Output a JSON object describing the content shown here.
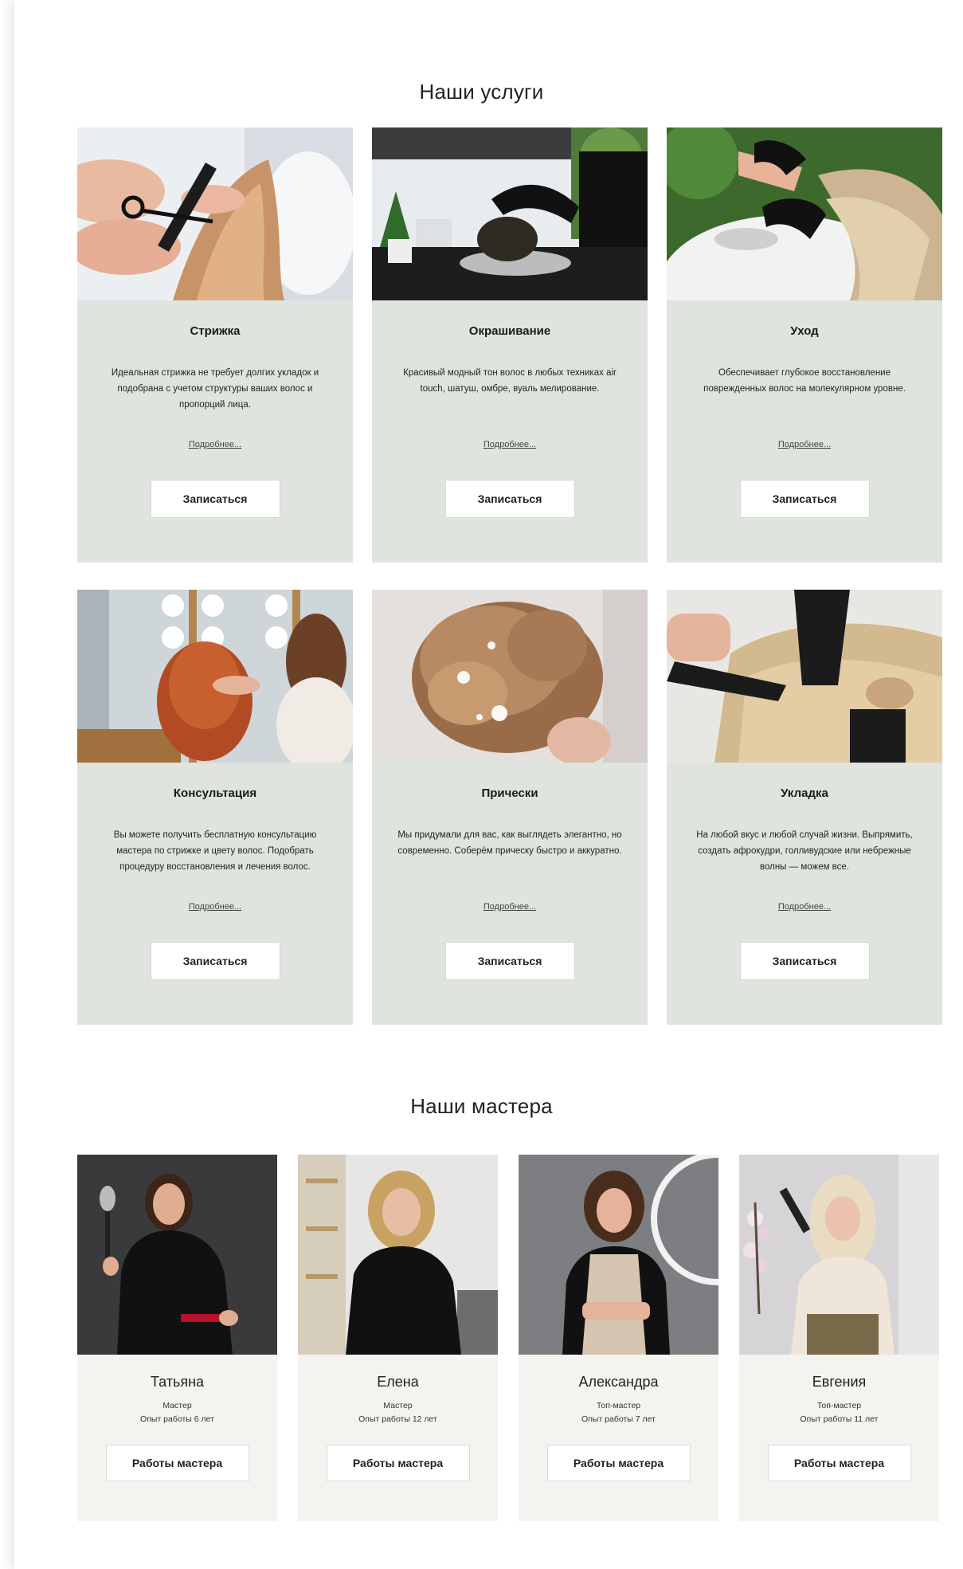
{
  "services": {
    "title": "Наши услуги",
    "cards": [
      {
        "title": "Стрижка",
        "description": "Идеальная стрижка не требует долгих укладок и подобрана с учетом структуры ваших волос и пропорций лица.",
        "more_label": "Подробнее...",
        "button_label": "Записаться"
      },
      {
        "title": "Окрашивание",
        "description": "Красивый модный тон волос в любых техниках air touch, шатуш, омбре, вуаль мелирование.",
        "more_label": "Подробнее...",
        "button_label": "Записаться"
      },
      {
        "title": "Уход",
        "description": "Обеспечивает глубокое восстановление поврежденных волос на молекулярном уровне.",
        "more_label": "Подробнее...",
        "button_label": "Записаться"
      },
      {
        "title": "Консультация",
        "description": "Вы можете получить бесплатную консультацию мастера по стрижке и цвету волос. Подобрать процедуру восстановления и лечения волос.",
        "more_label": "Подробнее...",
        "button_label": "Записаться"
      },
      {
        "title": "Прически",
        "description": "Мы придумали для вас, как выглядеть элегантно, но современно. Соберём прическу быстро и аккуратно.",
        "more_label": "Подробнее...",
        "button_label": "Записаться"
      },
      {
        "title": "Укладка",
        "description": "На любой вкус и любой случай жизни. Выпрямить, создать афрокудри, голливудские или небрежные волны — можем все.",
        "more_label": "Подробнее...",
        "button_label": "Записаться"
      }
    ]
  },
  "masters": {
    "title": "Наши мастера",
    "cards": [
      {
        "name": "Татьяна",
        "role": "Мастер",
        "experience": "Опыт работы 6 лет",
        "button_label": "Работы мастера"
      },
      {
        "name": "Елена",
        "role": "Мастер",
        "experience": "Опыт работы 12 лет",
        "button_label": "Работы мастера"
      },
      {
        "name": "Александра",
        "role": "Топ-мастер",
        "experience": "Опыт работы 7 лет",
        "button_label": "Работы мастера"
      },
      {
        "name": "Евгения",
        "role": "Топ-мастер",
        "experience": "Опыт работы 11 лет",
        "button_label": "Работы мастера"
      }
    ]
  },
  "colors": {
    "service_card_bg": "#dfe4df",
    "master_card_bg": "#f3f3ef",
    "button_bg": "#ffffff"
  }
}
